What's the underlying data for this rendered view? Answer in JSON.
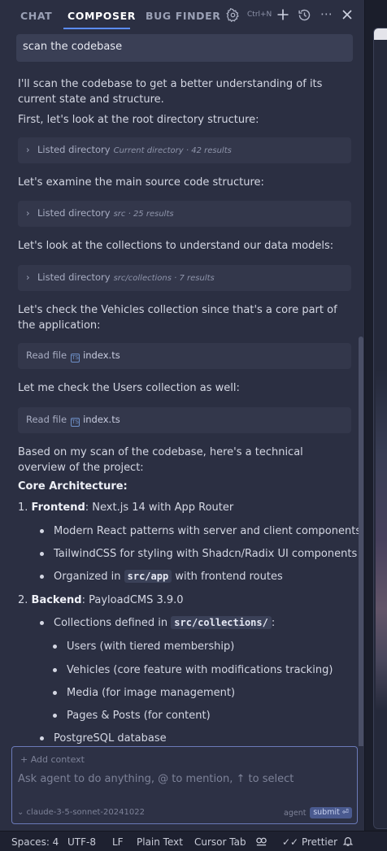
{
  "tabs": [
    {
      "label": "CHAT"
    },
    {
      "label": "COMPOSER"
    },
    {
      "label": "BUG FINDER"
    }
  ],
  "header": {
    "shortcut": "Ctrl+N",
    "icons": [
      "gear-icon",
      "plus-icon",
      "history-icon",
      "more-icon",
      "close-icon"
    ]
  },
  "conversation": {
    "user_message": "scan the codebase",
    "intro": "I'll scan the codebase to get a better understanding of its current state and structure.",
    "step1": "First, let's look at the root directory structure:",
    "tool1": {
      "action": "Listed directory",
      "meta": "Current directory · 42 results"
    },
    "step2": "Let's examine the main source code structure:",
    "tool2": {
      "action": "Listed directory",
      "meta": "src · 25 results"
    },
    "step3": "Let's look at the collections to understand our data models:",
    "tool3": {
      "action": "Listed directory",
      "meta": "src/collections · 7 results"
    },
    "step4": "Let's check the Vehicles collection since that's a core part of the application:",
    "tool4": {
      "action": "Read file",
      "file": "index.ts"
    },
    "step5": "Let me check the Users collection as well:",
    "tool5": {
      "action": "Read file",
      "file": "index.ts"
    },
    "summary": "Based on my scan of the codebase, here's a technical overview of the project:",
    "heading": "Core Architecture:",
    "item1": {
      "num": "1.",
      "title": "Frontend",
      "desc": ": Next.js 14 with App Router",
      "bullets": [
        "Modern React patterns with server and client components",
        "TailwindCSS for styling with Shadcn/Radix UI components"
      ],
      "bullet3_pre": "Organized in",
      "bullet3_code": "src/app",
      "bullet3_post": "with frontend routes"
    },
    "item2": {
      "num": "2.",
      "title": "Backend",
      "desc": ": PayloadCMS 3.9.0",
      "bullet1_pre": "Collections defined in",
      "bullet1_code": "src/collections/",
      "bullet1_post": ":",
      "sub_bullets": [
        "Users (with tiered membership)",
        "Vehicles (core feature with modifications tracking)",
        "Media (for image management)",
        "Pages & Posts (for content)"
      ],
      "bullet2": "PostgreSQL database"
    }
  },
  "composer_input": {
    "add_context": "+ Add context",
    "placeholder": "Ask agent to do anything, @ to mention, ↑ to select",
    "model": "⌄ claude-3-5-sonnet-20241022",
    "mode": "agent",
    "submit": "submit ⏎"
  },
  "statusbar": {
    "spaces": "Spaces: 4",
    "encoding": "UTF-8",
    "eol": "LF",
    "language": "Plain Text",
    "cursor_tab": "Cursor Tab",
    "prettier": "Prettier"
  }
}
